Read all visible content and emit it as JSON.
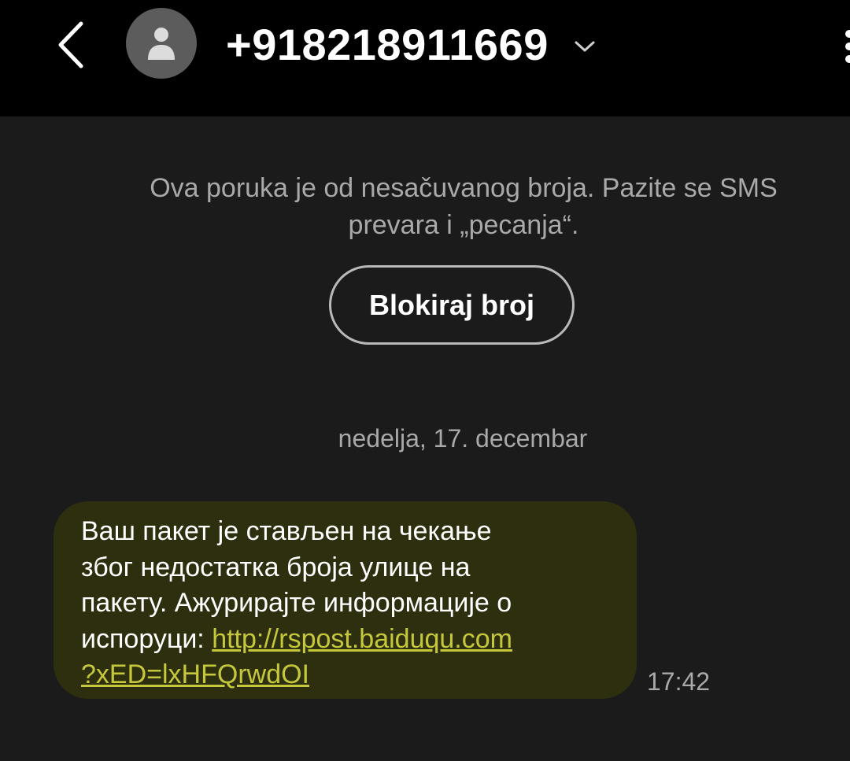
{
  "header": {
    "phone_number": "+918218911669",
    "back_icon": "chevron-left-icon",
    "avatar_icon": "person-icon",
    "expand_icon": "chevron-down-icon",
    "more_icon": "more-vertical-icon"
  },
  "warning": {
    "text_line1": "Ova poruka je od nesačuvanog broja. Pazite se SMS",
    "text_line2": "prevara i „pecanja“."
  },
  "block_button": {
    "label": "Blokiraj broj"
  },
  "conversation": {
    "date": "nedelja, 17. decembar",
    "messages": [
      {
        "text_line1": "Ваш пакет је стављен на чекање",
        "text_line2": "због недостатка броја улице на",
        "text_line3": "пакету. Ажурирајте информације о",
        "text_line4_prefix": "испоруци: ",
        "link_part1": "http://rspost.baiduqu.com",
        "link_part2": "?xED=lxHFQrwdOI",
        "time": "17:42"
      }
    ]
  },
  "colors": {
    "header_bg": "#000000",
    "screen_bg": "#1b1b1b",
    "bubble_bg": "#2e2f0f",
    "link": "#c5c83a",
    "secondary_text": "#a9a9a9"
  }
}
